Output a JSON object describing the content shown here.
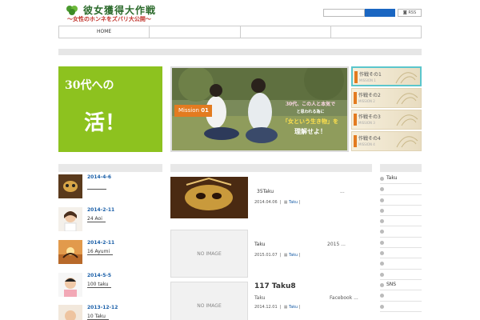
{
  "site": {
    "title": "彼女獲得大作戦",
    "subtitle": "〜女性のホンネをズバリ大公開〜",
    "rss_label": "RSS"
  },
  "search": {
    "value": "",
    "placeholder": ""
  },
  "nav": {
    "items": [
      "HOME",
      "",
      "",
      ""
    ]
  },
  "promo": {
    "line1": "30代への",
    "line2": "活！"
  },
  "slider": {
    "mission_label": "Mission",
    "mission_number": "01",
    "text_line1": "30代、この人と本気で",
    "text_line2": "と思われる為に",
    "text_line3": "「女という生き物」を",
    "text_line4": "理解せよ！"
  },
  "thumbs": [
    {
      "title": "作戦その1",
      "sub": "MISSION 1"
    },
    {
      "title": "作戦その2",
      "sub": "MISSION 2"
    },
    {
      "title": "作戦その3",
      "sub": "MISSION 3"
    },
    {
      "title": "作戦その4",
      "sub": "MISSION 4"
    }
  ],
  "recent": [
    {
      "date": "2014-4-6",
      "text": ""
    },
    {
      "date": "2014-2-11",
      "text": "24 Aoi"
    },
    {
      "date": "2014-2-11",
      "text": "16 Ayumi"
    },
    {
      "date": "2014-5-5",
      "text": "100 taku"
    },
    {
      "date": "2013-12-12",
      "text": "10 Taku"
    }
  ],
  "posts": [
    {
      "title": "35Taku",
      "excerpt": "...",
      "date": "2014.04.06",
      "category": "Taku"
    },
    {
      "title": "Taku",
      "excerpt": "2015 ...",
      "date": "2015.01.07",
      "category": "Taku",
      "noimage": "NO IMAGE"
    },
    {
      "title": "117 Taku8",
      "subtitle": "Taku",
      "excerpt": "Facebook ...",
      "date": "2014.12.01",
      "category": "Taku",
      "noimage": "NO IMAGE"
    }
  ],
  "sidebar": {
    "items": [
      "Taku",
      "",
      "",
      "",
      "",
      "",
      "",
      "",
      "",
      "",
      "SNS",
      "",
      "",
      ""
    ]
  },
  "colors": {
    "accent": "#8dc21f",
    "link": "#1a5fa8",
    "search_button": "#1a66c2",
    "highlight": "#e37b20"
  }
}
